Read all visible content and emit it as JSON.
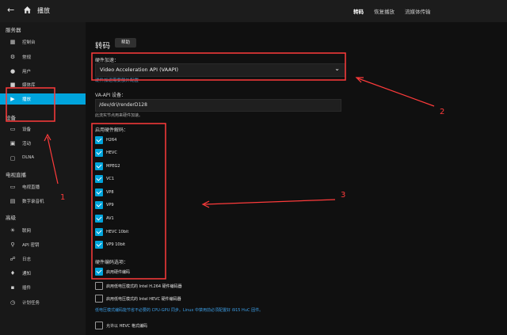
{
  "header": {
    "back_icon": "arrow-left-icon",
    "home_icon": "home-icon",
    "title": "播放",
    "tabs": [
      {
        "label": "转码",
        "active": true
      },
      {
        "label": "恢复播放",
        "active": false
      },
      {
        "label": "流媒体传输",
        "active": false
      }
    ]
  },
  "sidebar": {
    "sections": [
      {
        "label": "服务器"
      },
      {
        "label": "设备"
      },
      {
        "label": "电视直播"
      },
      {
        "label": "高级"
      }
    ],
    "items": [
      {
        "label": "控制台",
        "icon": "dashboard-icon"
      },
      {
        "label": "常规",
        "icon": "settings-icon"
      },
      {
        "label": "用户",
        "icon": "users-icon"
      },
      {
        "label": "媒体库",
        "icon": "folder-icon"
      },
      {
        "label": "播放",
        "icon": "play-icon",
        "active": true
      },
      {
        "label": "设备",
        "icon": "devices-icon"
      },
      {
        "label": "活动",
        "icon": "activity-icon"
      },
      {
        "label": "DLNA",
        "icon": "dlna-icon"
      },
      {
        "label": "电视直播",
        "icon": "tv-icon"
      },
      {
        "label": "数字录音机",
        "icon": "dvr-icon"
      },
      {
        "label": "联网",
        "icon": "network-icon"
      },
      {
        "label": "API 密钥",
        "icon": "key-icon"
      },
      {
        "label": "日志",
        "icon": "log-icon"
      },
      {
        "label": "通知",
        "icon": "bell-icon"
      },
      {
        "label": "插件",
        "icon": "cart-icon"
      },
      {
        "label": "计划任务",
        "icon": "clock-icon"
      }
    ]
  },
  "main": {
    "heading": "转码",
    "help_label": "帮助",
    "hw_accel_label": "硬件加速：",
    "hw_accel_value": "Video Acceleration API (VAAPI)",
    "hw_accel_link": "硬件加速需要额外配置",
    "vaapi_label": "VA-API 设备：",
    "vaapi_value": "/dev/dri/renderD128",
    "vaapi_hint": "此流实节点用来硬件加速。",
    "decode_label": "启用硬件解码：",
    "codecs": [
      {
        "label": "H264",
        "checked": true
      },
      {
        "label": "HEVC",
        "checked": true
      },
      {
        "label": "MPEG2",
        "checked": true
      },
      {
        "label": "VC1",
        "checked": true
      },
      {
        "label": "VP8",
        "checked": true
      },
      {
        "label": "VP9",
        "checked": true
      },
      {
        "label": "AV1",
        "checked": true
      },
      {
        "label": "HEVC 10bit",
        "checked": true
      },
      {
        "label": "VP9 10bit",
        "checked": true
      }
    ],
    "encode_label": "硬件编码选项：",
    "encode_options": [
      {
        "label": "启用硬件编码",
        "checked": true
      },
      {
        "label": "启用低电压模式的 Intel H.264 硬件编码器",
        "checked": false
      },
      {
        "label": "启用低电压模式的 Intel HEVC 硬件编码器",
        "checked": false
      }
    ],
    "lowpower_note": "低电压模式编码能节省不必要的 CPU-GPU 同步。Linux 中禁用前必须配置好 i915 HuC 固件。",
    "hevc_option": {
      "label": "允许以 HEVC 格式编码",
      "checked": false
    }
  },
  "annotations": {
    "numbers": [
      "1",
      "2",
      "3"
    ],
    "color": "#ff3b3b"
  },
  "colors": {
    "accent": "#00a4dc",
    "background": "#101010",
    "sidebar": "#181818",
    "annotation": "#ff3b3b"
  }
}
